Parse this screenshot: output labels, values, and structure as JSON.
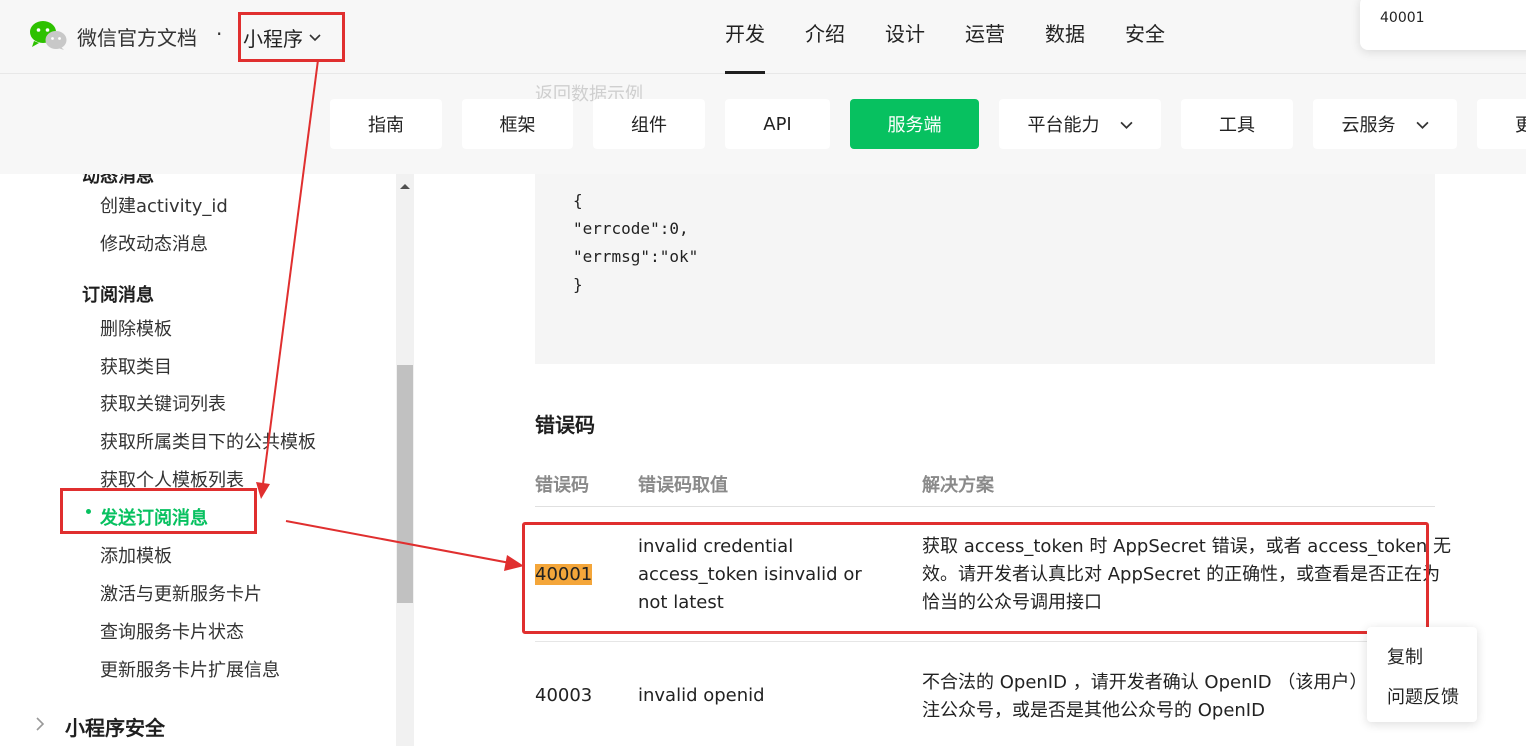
{
  "header": {
    "brand": "微信官方文档",
    "separator": "·",
    "product": "小程序",
    "nav": [
      "开发",
      "介绍",
      "设计",
      "运营",
      "数据",
      "安全"
    ],
    "active_nav": "开发",
    "search_popup": "40001"
  },
  "subnav": {
    "ghost_heading": "返回数据示例",
    "buttons": [
      "指南",
      "框架",
      "组件",
      "API",
      "服务端",
      "平台能力",
      "工具",
      "云服务",
      "更"
    ],
    "active": "服务端"
  },
  "sidebar": {
    "cut_heading": "动态消息",
    "items_top": [
      "创建activity_id",
      "修改动态消息"
    ],
    "group": "订阅消息",
    "items": [
      "删除模板",
      "获取类目",
      "获取关键词列表",
      "获取所属类目下的公共模板",
      "获取个人模板列表",
      "发送订阅消息",
      "添加模板",
      "激活与更新服务卡片",
      "查询服务卡片状态",
      "更新服务卡片扩展信息"
    ],
    "current": "发送订阅消息",
    "next_section": "小程序安全"
  },
  "content": {
    "code_lines": [
      "{",
      "\"errcode\":0,",
      "\"errmsg\":\"ok\"",
      "}"
    ],
    "error_title": "错误码",
    "table": {
      "headers": [
        "错误码",
        "错误码取值",
        "解决方案"
      ],
      "rows": [
        {
          "code": "40001",
          "value_lines": [
            "invalid credential",
            "access_token isinvalid or",
            "not latest"
          ],
          "solution_lines": [
            "获取 access_token 时 AppSecret 错误，或者 access_token 无",
            "效。请开发者认真比对 AppSecret 的正确性，或查看是否正在为",
            "恰当的公众号调用接口"
          ]
        },
        {
          "code": "40003",
          "value_lines": [
            "invalid openid"
          ],
          "solution_lines": [
            "不合法的 OpenID ，请开发者确认 OpenID （该用户）是",
            "注公众号，或是否是其他公众号的 OpenID"
          ]
        }
      ]
    }
  },
  "context_menu": [
    "复制",
    "问题反馈"
  ],
  "colors": {
    "accent_green": "#07c160",
    "annotation_red": "#e02f2f",
    "highlight_orange": "#f4a63a"
  }
}
